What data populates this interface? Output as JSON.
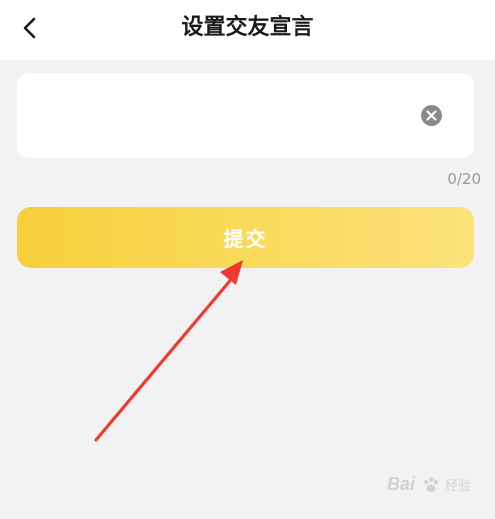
{
  "header": {
    "title": "设置交友宣言",
    "back_icon": "chevron-left-icon"
  },
  "input": {
    "value": "",
    "placeholder": "",
    "clear_icon": "clear-circle-icon"
  },
  "counter": {
    "text": "0/20"
  },
  "submit": {
    "label": "提交"
  },
  "watermark": {
    "brand": "Bai",
    "sub": "经验"
  },
  "colors": {
    "accent_start": "#f6cf3a",
    "accent_end": "#fde27c",
    "arrow": "#f03a2e",
    "background": "#f2f2f4"
  }
}
